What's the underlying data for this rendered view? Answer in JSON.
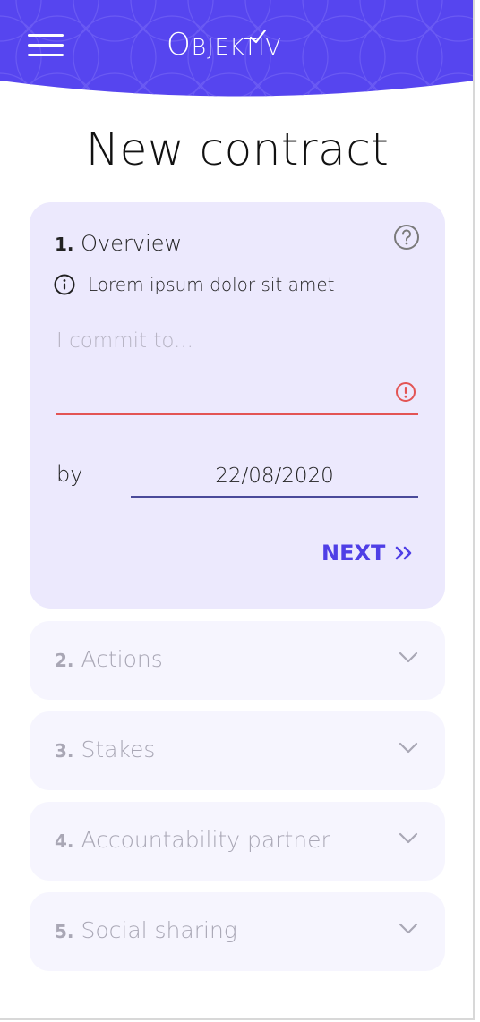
{
  "header": {
    "logo_initial": "O",
    "logo_rest": "BJEKTIV",
    "menu_icon": "hamburger-icon",
    "bg_color": "#5645ef"
  },
  "page_title": "New contract",
  "active_step": {
    "number": "1.",
    "title": "Overview",
    "help_icon": "question-circle-icon",
    "info_icon": "info-circle-icon",
    "info_text": "Lorem ipsum dolor sit amet",
    "commit_placeholder": "I commit to...",
    "commit_value": "",
    "error_icon": "exclamation-circle-icon",
    "by_label": "by",
    "date_value": "22/08/2020",
    "next_label": "NEXT",
    "next_icon": "double-chevron-right-icon",
    "accent_color": "#4f3fe6",
    "error_color": "#e35454"
  },
  "steps": [
    {
      "number": "2.",
      "title": "Actions",
      "icon": "chevron-down-icon"
    },
    {
      "number": "3.",
      "title": "Stakes",
      "icon": "chevron-down-icon"
    },
    {
      "number": "4.",
      "title": "Accountability partner",
      "icon": "chevron-down-icon"
    },
    {
      "number": "5.",
      "title": "Social sharing",
      "icon": "chevron-down-icon"
    }
  ]
}
